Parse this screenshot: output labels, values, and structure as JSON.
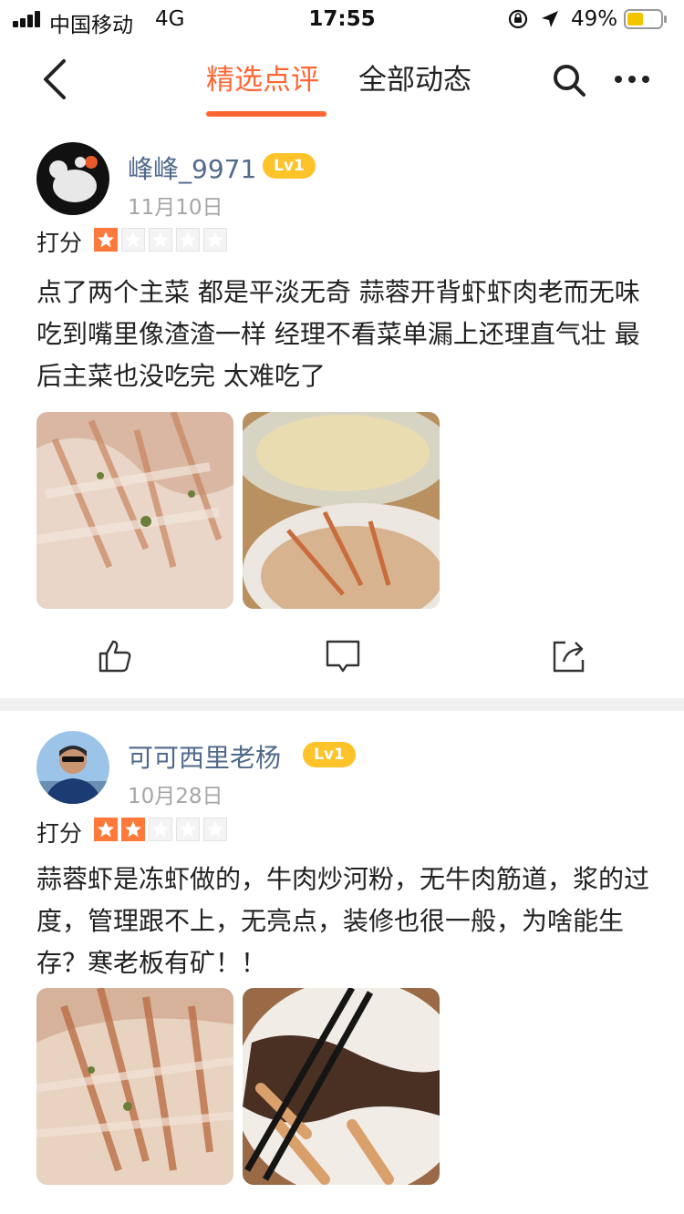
{
  "status_bar": {
    "carrier": "中国移动",
    "network": "4G",
    "time": "17:55",
    "battery_percent": "49%",
    "battery_level": 0.49,
    "icons": [
      "signal-icon",
      "orientation-lock-icon",
      "location-arrow-icon",
      "battery-icon"
    ]
  },
  "nav": {
    "tabs": [
      {
        "label": "精选点评",
        "active": true
      },
      {
        "label": "全部动态",
        "active": false
      }
    ],
    "icons": [
      "back-icon",
      "search-icon",
      "more-icon"
    ],
    "accent_color": "#ff6633"
  },
  "reviews": [
    {
      "username": "峰峰_9971",
      "level": "Lv1",
      "date": "11月10日",
      "score_label": "打分",
      "rating": 1,
      "max_rating": 5,
      "content": "点了两个主菜 都是平淡无奇 蒜蓉开背虾虾肉老而无味 吃到嘴里像渣渣一样 经理不看菜单漏上还理直气壮 最后主菜也没吃完 太难吃了",
      "photo_count": 2
    },
    {
      "username": "可可西里老杨",
      "level": "Lv1",
      "date": "10月28日",
      "score_label": "打分",
      "rating": 2,
      "max_rating": 5,
      "content": "蒜蓉虾是冻虾做的，牛肉炒河粉，无牛肉筋道，浆的过度，管理跟不上，无亮点，装修也很一般，为啥能生存？寒老板有矿！！",
      "photo_count": 2
    }
  ],
  "actions": [
    "like-icon",
    "comment-icon",
    "share-icon"
  ],
  "colors": {
    "username": "#516a8c",
    "badge": "#ffc32a",
    "star_on": "#ff7a3a",
    "date": "#a6a6a6"
  }
}
